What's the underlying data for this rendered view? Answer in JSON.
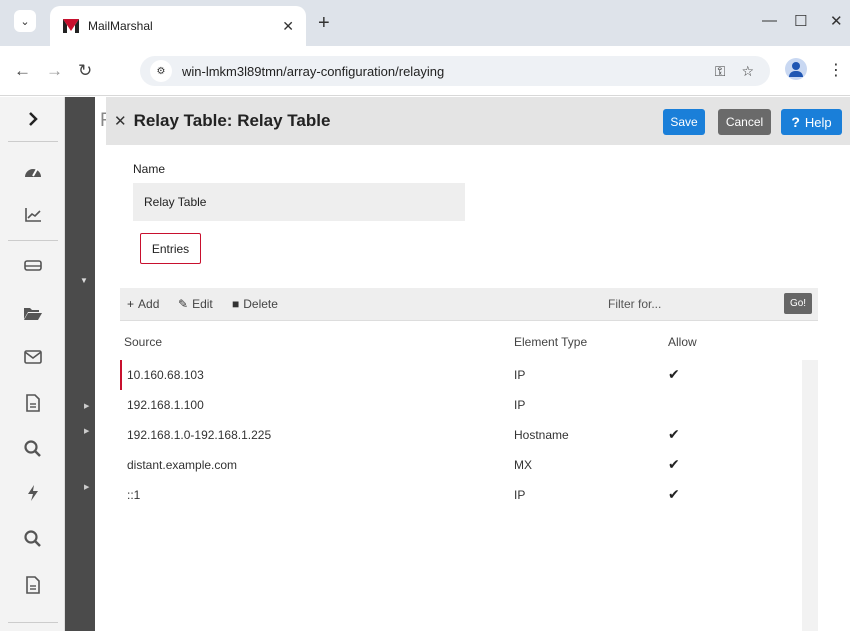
{
  "browser": {
    "tab_title": "MailMarshal",
    "url": "win-lmkm3l89tmn/array-configuration/relaying"
  },
  "sidebar": {
    "expand_icon": "chevron-right-icon",
    "items": [
      {
        "name": "dashboard",
        "icon": "dashboard-gauge-icon"
      },
      {
        "name": "reports",
        "icon": "chart-line-icon"
      },
      {
        "name": "server",
        "icon": "hard-drive-icon"
      },
      {
        "name": "folders",
        "icon": "folder-open-icon"
      },
      {
        "name": "mail",
        "icon": "envelope-icon"
      },
      {
        "name": "documents",
        "icon": "document-icon"
      },
      {
        "name": "search",
        "icon": "search-icon"
      },
      {
        "name": "events",
        "icon": "lightning-icon"
      },
      {
        "name": "search-2",
        "icon": "search-icon"
      },
      {
        "name": "documents-2",
        "icon": "document-icon"
      }
    ]
  },
  "background_panel": {
    "title_letter": "F"
  },
  "panel": {
    "title": "Relay Table: Relay Table",
    "save_label": "Save",
    "cancel_label": "Cancel",
    "help_label": "Help",
    "help_glyph": "?",
    "name_label": "Name",
    "name_value": "Relay Table",
    "entries_tab": "Entries"
  },
  "toolbar": {
    "add_label": "Add",
    "edit_label": "Edit",
    "delete_label": "Delete",
    "filter_placeholder": "Filter for...",
    "go_label": "Go!"
  },
  "table": {
    "columns": [
      "Source",
      "Element Type",
      "Allow"
    ],
    "rows": [
      {
        "source": "10.160.68.103",
        "type": "IP",
        "allow": true,
        "selected": true
      },
      {
        "source": "192.168.1.100",
        "type": "IP",
        "allow": false,
        "selected": false
      },
      {
        "source": "192.168.1.0-192.168.1.225",
        "type": "Hostname",
        "allow": true,
        "selected": false
      },
      {
        "source": "distant.example.com",
        "type": "MX",
        "allow": true,
        "selected": false
      },
      {
        "source": "::1",
        "type": "IP",
        "allow": true,
        "selected": false
      }
    ]
  },
  "colors": {
    "accent_red": "#c8102e",
    "primary_blue": "#1a7fd9"
  }
}
